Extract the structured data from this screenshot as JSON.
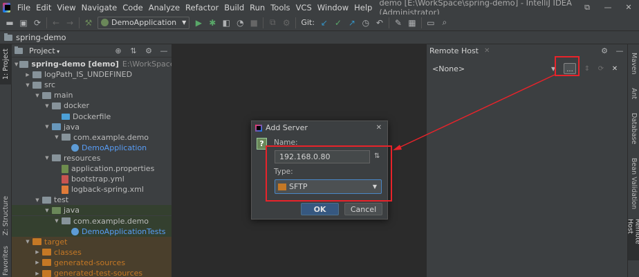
{
  "menubar": {
    "items": [
      "File",
      "Edit",
      "View",
      "Navigate",
      "Code",
      "Analyze",
      "Refactor",
      "Build",
      "Run",
      "Tools",
      "VCS",
      "Window",
      "Help"
    ],
    "window_title": "demo [E:\\WorkSpace\\spring-demo] - IntelliJ IDEA (Administrator)",
    "controls": [
      "⧉",
      "—",
      "✕"
    ]
  },
  "toolbar": {
    "run_config": "DemoApplication",
    "git_label": "Git:"
  },
  "breadcrumb": {
    "project": "spring-demo"
  },
  "left_stripe": {
    "project_tab": "1: Project",
    "structure_tab": "Z: Structure",
    "favorites_tab": "Favorites"
  },
  "project_panel": {
    "title": "Project",
    "tree": [
      {
        "label": "spring-demo [demo]",
        "path": "E:\\WorkSpace\\spring",
        "icon": "folder",
        "style": "bold",
        "depth": 0,
        "arrow": "down"
      },
      {
        "label": "logPath_IS_UNDEFINED",
        "icon": "folder",
        "style": "",
        "depth": 1,
        "arrow": "right"
      },
      {
        "label": "src",
        "icon": "folder",
        "style": "",
        "depth": 1,
        "arrow": "down"
      },
      {
        "label": "main",
        "icon": "folder",
        "style": "",
        "depth": 2,
        "arrow": "down"
      },
      {
        "label": "docker",
        "icon": "folder",
        "style": "",
        "depth": 3,
        "arrow": "down"
      },
      {
        "label": "Dockerfile",
        "icon": "docker",
        "style": "",
        "depth": 4,
        "arrow": ""
      },
      {
        "label": "java",
        "icon": "folder-blue",
        "style": "",
        "depth": 3,
        "arrow": "down"
      },
      {
        "label": "com.example.demo",
        "icon": "folder",
        "style": "",
        "depth": 4,
        "arrow": "down"
      },
      {
        "label": "DemoApplication",
        "icon": "class",
        "style": "blue",
        "depth": 5,
        "arrow": ""
      },
      {
        "label": "resources",
        "icon": "folder",
        "style": "",
        "depth": 3,
        "arrow": "down"
      },
      {
        "label": "application.properties",
        "icon": "props",
        "style": "",
        "depth": 4,
        "arrow": ""
      },
      {
        "label": "bootstrap.yml",
        "icon": "yml",
        "style": "",
        "depth": 4,
        "arrow": ""
      },
      {
        "label": "logback-spring.xml",
        "icon": "xml",
        "style": "",
        "depth": 4,
        "arrow": ""
      },
      {
        "label": "test",
        "icon": "folder",
        "style": "",
        "depth": 2,
        "arrow": "down"
      },
      {
        "label": "java",
        "icon": "folder-green",
        "style": "test",
        "depth": 3,
        "arrow": "down"
      },
      {
        "label": "com.example.demo",
        "icon": "folder",
        "style": "test",
        "depth": 4,
        "arrow": "down"
      },
      {
        "label": "DemoApplicationTests",
        "icon": "class",
        "style": "blue-test",
        "depth": 5,
        "arrow": ""
      },
      {
        "label": "target",
        "icon": "folder-orange",
        "style": "orange",
        "depth": 1,
        "arrow": "down"
      },
      {
        "label": "classes",
        "icon": "folder-orange",
        "style": "orange",
        "depth": 2,
        "arrow": "right"
      },
      {
        "label": "generated-sources",
        "icon": "folder-orange",
        "style": "orange",
        "depth": 2,
        "arrow": "right"
      },
      {
        "label": "generated-test-sources",
        "icon": "folder-orange",
        "style": "orange",
        "depth": 2,
        "arrow": "right"
      }
    ]
  },
  "remote_panel": {
    "title": "Remote Host",
    "host_value": "<None>",
    "ellipsis_label": "..."
  },
  "right_stripe": {
    "tabs": [
      "Maven",
      "Ant",
      "Database",
      "Bean Validation",
      "Remote Host"
    ]
  },
  "dialog": {
    "title": "Add Server",
    "name_label": "Name:",
    "name_value": "192.168.0.80",
    "type_label": "Type:",
    "type_value": "SFTP",
    "ok_label": "OK",
    "cancel_label": "Cancel"
  },
  "colors": {
    "annotation": "#e8232a",
    "accent": "#365880"
  }
}
